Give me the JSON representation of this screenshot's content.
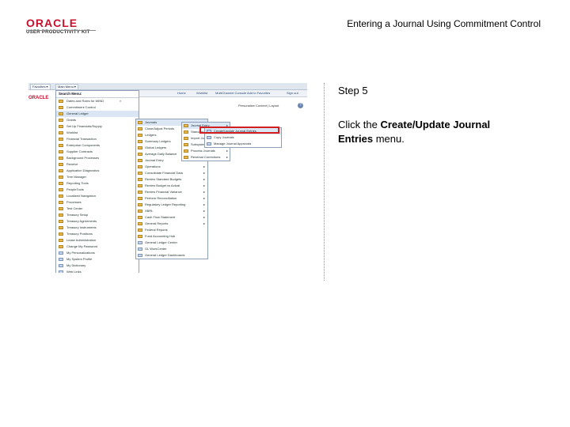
{
  "header": {
    "logo_word": "ORACLE",
    "logo_sub": "USER PRODUCTIVITY KIT",
    "doc_title": "Entering a Journal Using Commitment Control"
  },
  "screenshot": {
    "tabs": [
      "Favorites ▾",
      "Main Menu ▾"
    ],
    "links": [
      "Home",
      "Worklist",
      "MultiChannel Console",
      "Add to Favorites",
      "Sign out"
    ],
    "oracle_mini": "ORACLE",
    "personalize": "Personalize Content | Layout",
    "menu": {
      "title": "Search Menu:",
      "search_glyph": "⌕",
      "items": [
        "Dates and Roles for WIND",
        "Commitment Control",
        "General Ledger",
        "Grants",
        "Set Up Financials/Supply",
        "Worklist",
        "Financial Transaction",
        "Enterprise Components",
        "Supplier Contracts",
        "Background Processes",
        "Receive",
        "Application Diagnostics",
        "Tree Manager",
        "Reporting Tools",
        "PeopleTools",
        "Localized Navigation",
        "Processes",
        "Test Center",
        "Treasury Setup",
        "Treasury Agreements",
        "Treasury Instruments",
        "Treasury Positions",
        "Lease Administration",
        "Change My Password",
        "My Personalizations",
        "My System Profile",
        "My Dictionary",
        "Web Links"
      ]
    },
    "submenu1": {
      "items": [
        "Journals",
        "Close/Adjust Periods",
        "Ledgers",
        "Summary Ledgers",
        "Global Ledgers",
        "Average Daily Balance",
        "Journal Entry",
        "Operations",
        "Consolidate Financial Data",
        "Review Standard Budgets",
        "Review Budget vs Actual",
        "Review Financial Variance",
        "Perform Reconciliation",
        "Regulatory Ledger Reporting",
        "XBRL",
        "Cash Flow Statement",
        "General Reports",
        "Federal Reports",
        "Fund Accounting Hub",
        "General Ledger Center",
        "GL WorkCenter",
        "General Ledger Dashboards"
      ]
    },
    "submenu2": {
      "items": [
        "Journal Entry",
        "Standard Journals",
        "Import Journals",
        "Subsystem Journals",
        "Process Journals",
        "Reversal Corrections"
      ]
    },
    "submenu3": {
      "items": [
        "Create/Update Journal Entries",
        "Copy Journals",
        "Manage Journal Approvals"
      ]
    }
  },
  "instruction": {
    "step": "Step 5",
    "prefix": "Click the ",
    "menu_name": "Create/Update Journal Entries",
    "suffix": " menu."
  }
}
